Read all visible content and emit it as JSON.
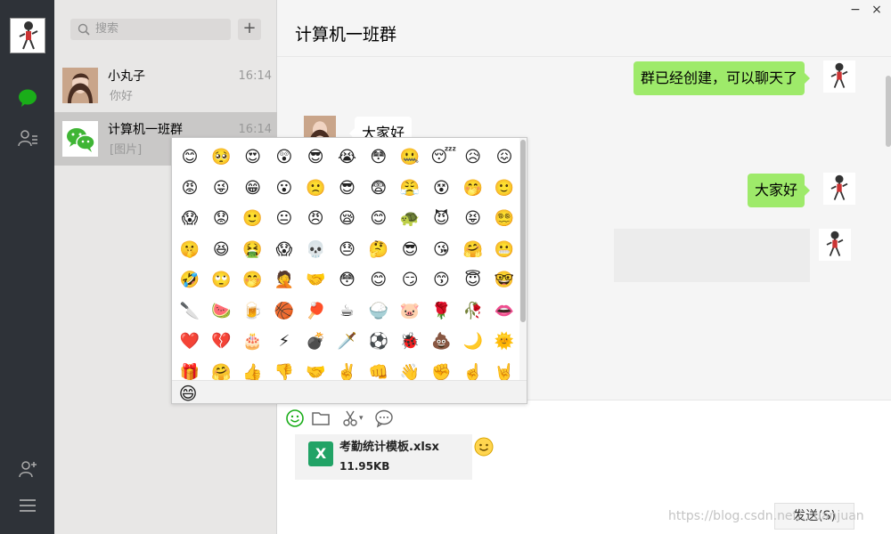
{
  "search": {
    "placeholder": "搜索",
    "add": "+"
  },
  "conversations": [
    {
      "name": "小丸子",
      "time": "16:14",
      "last": "你好",
      "active": false
    },
    {
      "name": "计算机一班群",
      "time": "16:14",
      "last": "[图片]",
      "active": true
    }
  ],
  "chat": {
    "title": "计算机一班群",
    "window": {
      "minimize": "−",
      "close": "×"
    },
    "messages": [
      {
        "side": "right",
        "text": "群已经创建，可以聊天了"
      },
      {
        "side": "left",
        "text": "大家好"
      },
      {
        "side": "right",
        "text": "大家好"
      },
      {
        "side": "right",
        "text": ""
      }
    ]
  },
  "toolbar": {
    "icons": [
      "emoji-icon",
      "folder-icon",
      "scissors-icon",
      "chat-history-icon"
    ],
    "scissors_arrow": "▾"
  },
  "attachment": {
    "name": "考勤统计模板.xlsx",
    "size": "11.95KB",
    "type_letter": "X"
  },
  "send_button": "发送(S)",
  "watermark": "https://blog.csdn.net/...uanjuan",
  "emoji_panel": {
    "rows": [
      [
        "😊",
        "🥺",
        "😍",
        "😲",
        "😎",
        "😭",
        "😳",
        "🤐",
        "😴",
        "😥",
        "😖"
      ],
      [
        "😡",
        "😜",
        "😁",
        "😮",
        "🙁",
        "😎",
        "😨",
        "😤",
        "😵",
        "🤭",
        "🙂"
      ],
      [
        "😱",
        "😟",
        "🙂",
        "😐",
        "😠",
        "😪",
        "😊",
        "🐢",
        "😈",
        "😝",
        "😵‍💫"
      ],
      [
        "🤫",
        "😆",
        "🤮",
        "😱",
        "💀",
        "😓",
        "🤔",
        "😎",
        "😘",
        "🤗",
        "😬"
      ],
      [
        "🤣",
        "🙄",
        "🤭",
        "🤦",
        "🤝",
        "😳",
        "😊",
        "😏",
        "😙",
        "😇",
        "🤓"
      ],
      [
        "🔪",
        "🍉",
        "🍺",
        "🏀",
        "🏓",
        "☕",
        "🍚",
        "🐷",
        "🌹",
        "🥀",
        "👄"
      ],
      [
        "❤️",
        "💔",
        "🎂",
        "⚡",
        "💣",
        "🗡️",
        "⚽",
        "🐞",
        "💩",
        "🌙",
        "🌞"
      ],
      [
        "🎁",
        "🤗",
        "👍",
        "👎",
        "🤝",
        "✌️",
        "👊",
        "👋",
        "✊",
        "☝️",
        "🤘"
      ]
    ],
    "tab_icon": "😄"
  },
  "colors": {
    "nav_bg": "#2e3238",
    "accent_green": "#9eea6a",
    "excel": "#21a366",
    "nav_active": "#1aad19"
  }
}
